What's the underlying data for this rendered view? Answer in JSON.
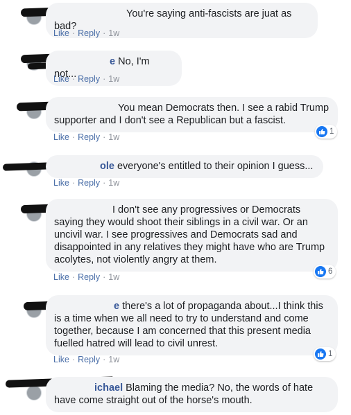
{
  "comments": [
    {
      "name": "",
      "text": "You're saying anti-fascists are juat as bad?",
      "actions": {
        "like": "Like",
        "reply": "Reply",
        "time": "1w"
      },
      "reactions": null
    },
    {
      "name": "e",
      "text": "No, I'm not...",
      "actions": {
        "like": "Like",
        "reply": "Reply",
        "time": "1w"
      },
      "reactions": null
    },
    {
      "name": "",
      "text": "You mean Democrats then. I see a rabid Trump supporter and I don't see a Republican but a fascist.",
      "actions": {
        "like": "Like",
        "reply": "Reply",
        "time": "1w"
      },
      "reactions": {
        "count": "1"
      }
    },
    {
      "name": "ole",
      "text": "everyone's entitled to their opinion I guess...",
      "actions": {
        "like": "Like",
        "reply": "Reply",
        "time": "1w"
      },
      "reactions": null
    },
    {
      "name": "",
      "text": "I don't see any progressives or Democrats saying they would shoot their siblings in a civil war. Or an uncivil war. I see progressives and Democrats sad and disappointed in any relatives they might have who are Trump acolytes, not violently angry at them.",
      "actions": {
        "like": "Like",
        "reply": "Reply",
        "time": "1w"
      },
      "reactions": {
        "count": "6"
      }
    },
    {
      "name": "e",
      "text": "there's a lot of propaganda about...I think this is a time when we all need to try to understand and come together, because I am concerned that this present media fuelled hatred will lead to civil unrest.",
      "actions": {
        "like": "Like",
        "reply": "Reply",
        "time": "1w"
      },
      "reactions": {
        "count": "1"
      }
    },
    {
      "name": "ichael",
      "text": "Blaming the media? No, the words of hate have come straight out of the horse's mouth.",
      "actions": {
        "like": "Like",
        "reply": "Reply",
        "time": "1w"
      },
      "reactions": null
    }
  ],
  "icons": {
    "reaction": "thumbs-up-icon"
  },
  "colors": {
    "link": "#4b6fa8",
    "bubble": "#f2f3f5",
    "like_blue": "#1877f2",
    "name": "#385898"
  }
}
